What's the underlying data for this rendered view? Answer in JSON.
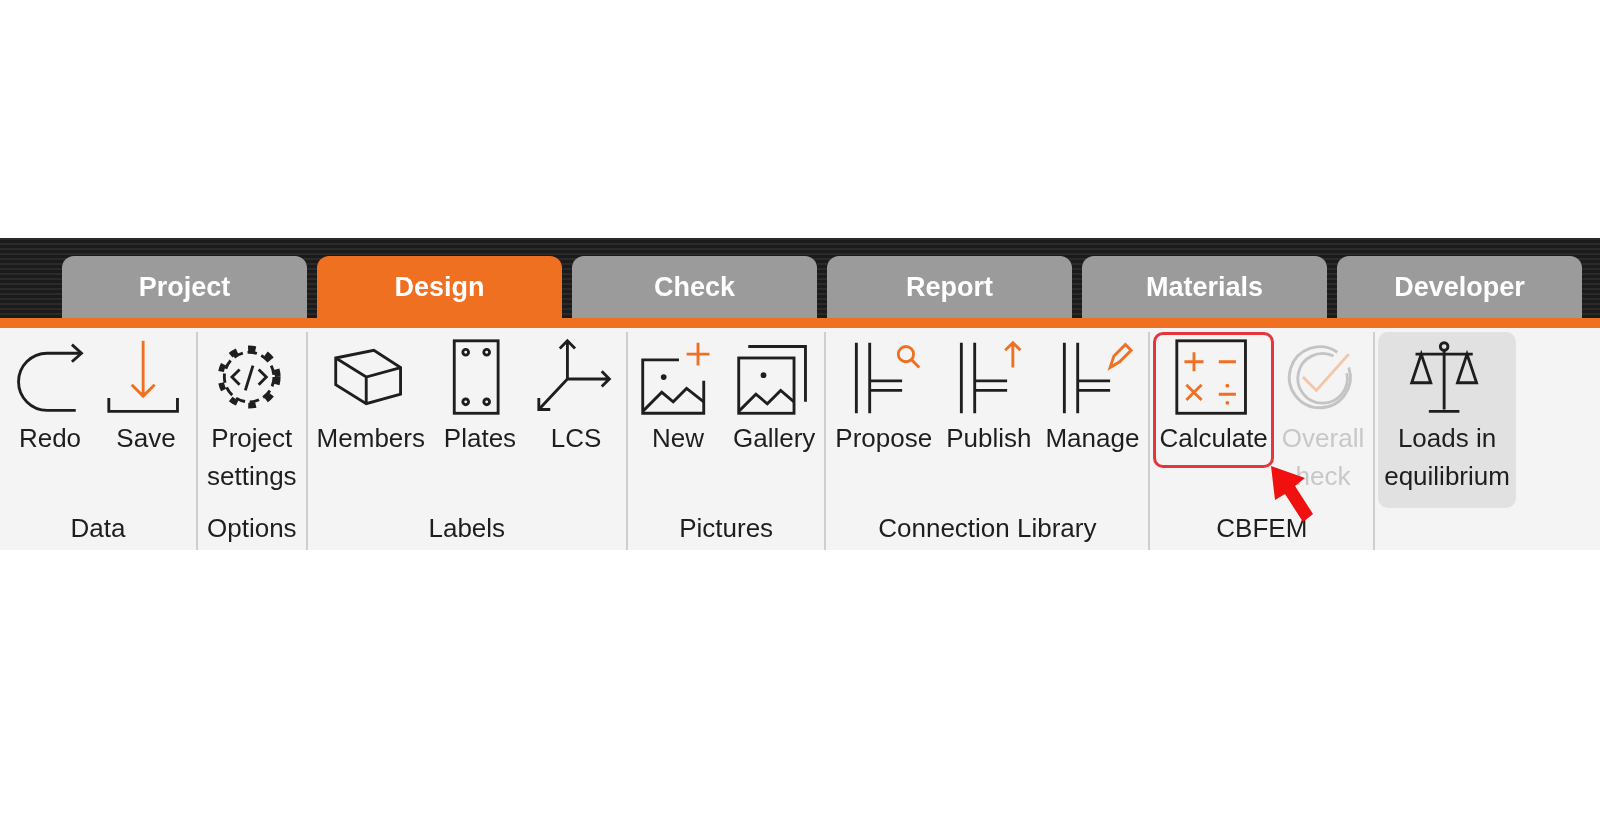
{
  "tabs": [
    {
      "label": "Project",
      "selected": false
    },
    {
      "label": "Design",
      "selected": true
    },
    {
      "label": "Check",
      "selected": false
    },
    {
      "label": "Report",
      "selected": false
    },
    {
      "label": "Materials",
      "selected": false
    },
    {
      "label": "Developer",
      "selected": false
    }
  ],
  "ribbon": {
    "groups": [
      {
        "label": "Data",
        "buttons": [
          {
            "label": "Redo",
            "disabled": false,
            "highlighted": false,
            "active": false
          },
          {
            "label": "Save",
            "disabled": false,
            "highlighted": false,
            "active": false
          }
        ]
      },
      {
        "label": "Options",
        "buttons": [
          {
            "label": "Project\nsettings",
            "disabled": false,
            "highlighted": false,
            "active": false
          }
        ]
      },
      {
        "label": "Labels",
        "buttons": [
          {
            "label": "Members",
            "disabled": false,
            "highlighted": false,
            "active": false
          },
          {
            "label": "Plates",
            "disabled": false,
            "highlighted": false,
            "active": false
          },
          {
            "label": "LCS",
            "disabled": false,
            "highlighted": false,
            "active": false
          }
        ]
      },
      {
        "label": "Pictures",
        "buttons": [
          {
            "label": "New",
            "disabled": false,
            "highlighted": false,
            "active": false
          },
          {
            "label": "Gallery",
            "disabled": false,
            "highlighted": false,
            "active": false
          }
        ]
      },
      {
        "label": "Connection Library",
        "buttons": [
          {
            "label": "Propose",
            "disabled": false,
            "highlighted": false,
            "active": false
          },
          {
            "label": "Publish",
            "disabled": false,
            "highlighted": false,
            "active": false
          },
          {
            "label": "Manage",
            "disabled": false,
            "highlighted": false,
            "active": false
          }
        ]
      },
      {
        "label": "CBFEM",
        "buttons": [
          {
            "label": "Calculate",
            "disabled": false,
            "highlighted": true,
            "active": false
          },
          {
            "label": "Overall\nheck",
            "disabled": true,
            "highlighted": false,
            "active": false
          }
        ]
      },
      {
        "buttons": [
          {
            "label": "Loads in\nequilibrium",
            "disabled": false,
            "highlighted": false,
            "active": true
          }
        ]
      }
    ]
  }
}
